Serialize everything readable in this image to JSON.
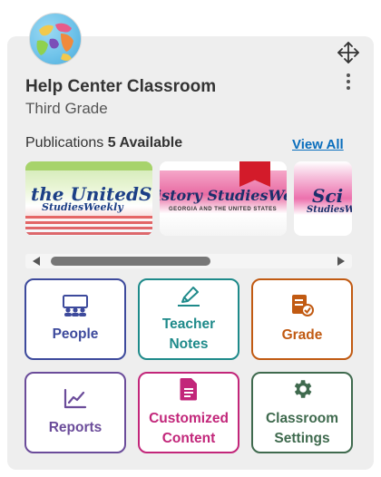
{
  "classroom": {
    "title": "Help Center Classroom",
    "grade": "Third Grade"
  },
  "publications": {
    "label": "Publications",
    "count_text": "5 Available",
    "view_all": "View All",
    "items": [
      {
        "cover_text": "the UnitedStates",
        "cover_sub": "StudiesWeekly"
      },
      {
        "cover_text": "istory StudiesWeekly",
        "cover_sub": "GEORGIA AND THE UNITED STATES",
        "bookmarked": true
      },
      {
        "cover_text": "Sci",
        "cover_sub": "StudiesWeek"
      }
    ]
  },
  "tiles": [
    {
      "label": "People",
      "icon": "people-icon",
      "color": "#3d4a9c"
    },
    {
      "label": "Teacher Notes",
      "icon": "highlighter-icon",
      "color": "#1e8a8a"
    },
    {
      "label": "Grade",
      "icon": "grade-document-icon",
      "color": "#c15a12"
    },
    {
      "label": "Reports",
      "icon": "chart-line-icon",
      "color": "#6b4c9a"
    },
    {
      "label": "Customized Content",
      "icon": "document-icon",
      "color": "#c2267a"
    },
    {
      "label": "Classroom Settings",
      "icon": "gear-icon",
      "color": "#3f6a4e"
    }
  ]
}
